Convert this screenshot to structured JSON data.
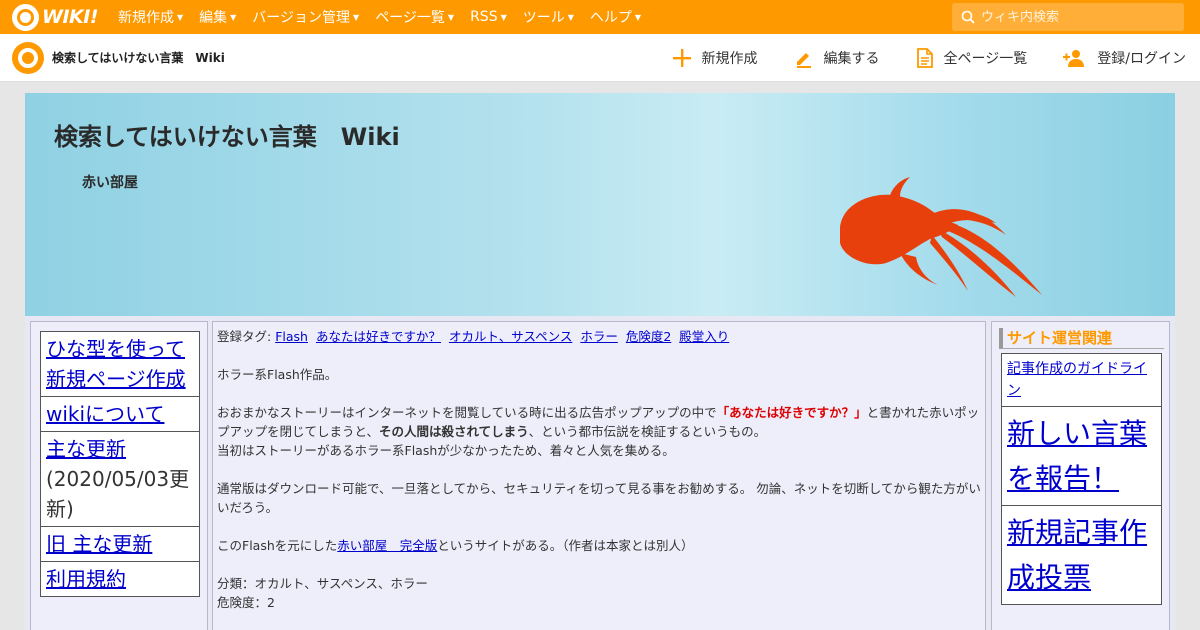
{
  "topbar": {
    "logo_text": "WIKI!",
    "menu": [
      "新規作成",
      "編集",
      "バージョン管理",
      "ページ一覧",
      "RSS",
      "ツール",
      "ヘルプ"
    ],
    "search_placeholder": "ウィキ内検索"
  },
  "secbar": {
    "site_title": "検索してはいけない言葉　Wiki",
    "nav": {
      "create": "新規作成",
      "edit": "編集する",
      "all_pages": "全ページ一覧",
      "login": "登録/ログイン"
    }
  },
  "banner": {
    "title": "検索してはいけない言葉　Wiki",
    "subtitle": "赤い部屋"
  },
  "left_menu": {
    "item1": "ひな型を使って新規ページ作成",
    "item2": "wikiについて",
    "item3": "主な更新",
    "item3_note": "(2020/05/03更新)",
    "item4": "旧 主な更新",
    "item5": "利用規約"
  },
  "main": {
    "tag_label": "登録タグ:",
    "tags": [
      "Flash",
      "あなたは好きですか？",
      "オカルト、サスペンス",
      "ホラー",
      "危険度2",
      "殿堂入り"
    ],
    "p1": "ホラー系Flash作品。",
    "p2_a": "おおまかなストーリーはインターネットを閲覧している時に出る広告ポップアップの中で",
    "p2_red": "「あなたは好きですか？」",
    "p2_b": "と書かれた赤いポップアップを閉じてしまうと、",
    "p2_bold": "その人間は殺されてしまう",
    "p2_c": "、という都市伝説を検証するというもの。",
    "p2_d": "当初はストーリーがあるホラー系Flashが少なかったため、着々と人気を集める。",
    "p3": "通常版はダウンロード可能で、一旦落としてから、セキュリティを切って見る事をお勧めする。 勿論、ネットを切断してから観た方がいいだろう。",
    "p4_a": "このFlashを元にした",
    "p4_link": "赤い部屋　完全版",
    "p4_b": "というサイトがある。（作者は本家とは別人）",
    "p5_a": "分類：オカルト、サスペンス、ホラー",
    "p5_b": "危険度：2"
  },
  "right": {
    "heading": "サイト運営関連",
    "item1": "記事作成のガイドライン",
    "item2": "新しい言葉を報告！",
    "item3": "新規記事作成投票"
  },
  "colors": {
    "brand": "#ff9900",
    "link": "#0000cc",
    "warning": "#dd0000",
    "fish": "#e8400c"
  }
}
